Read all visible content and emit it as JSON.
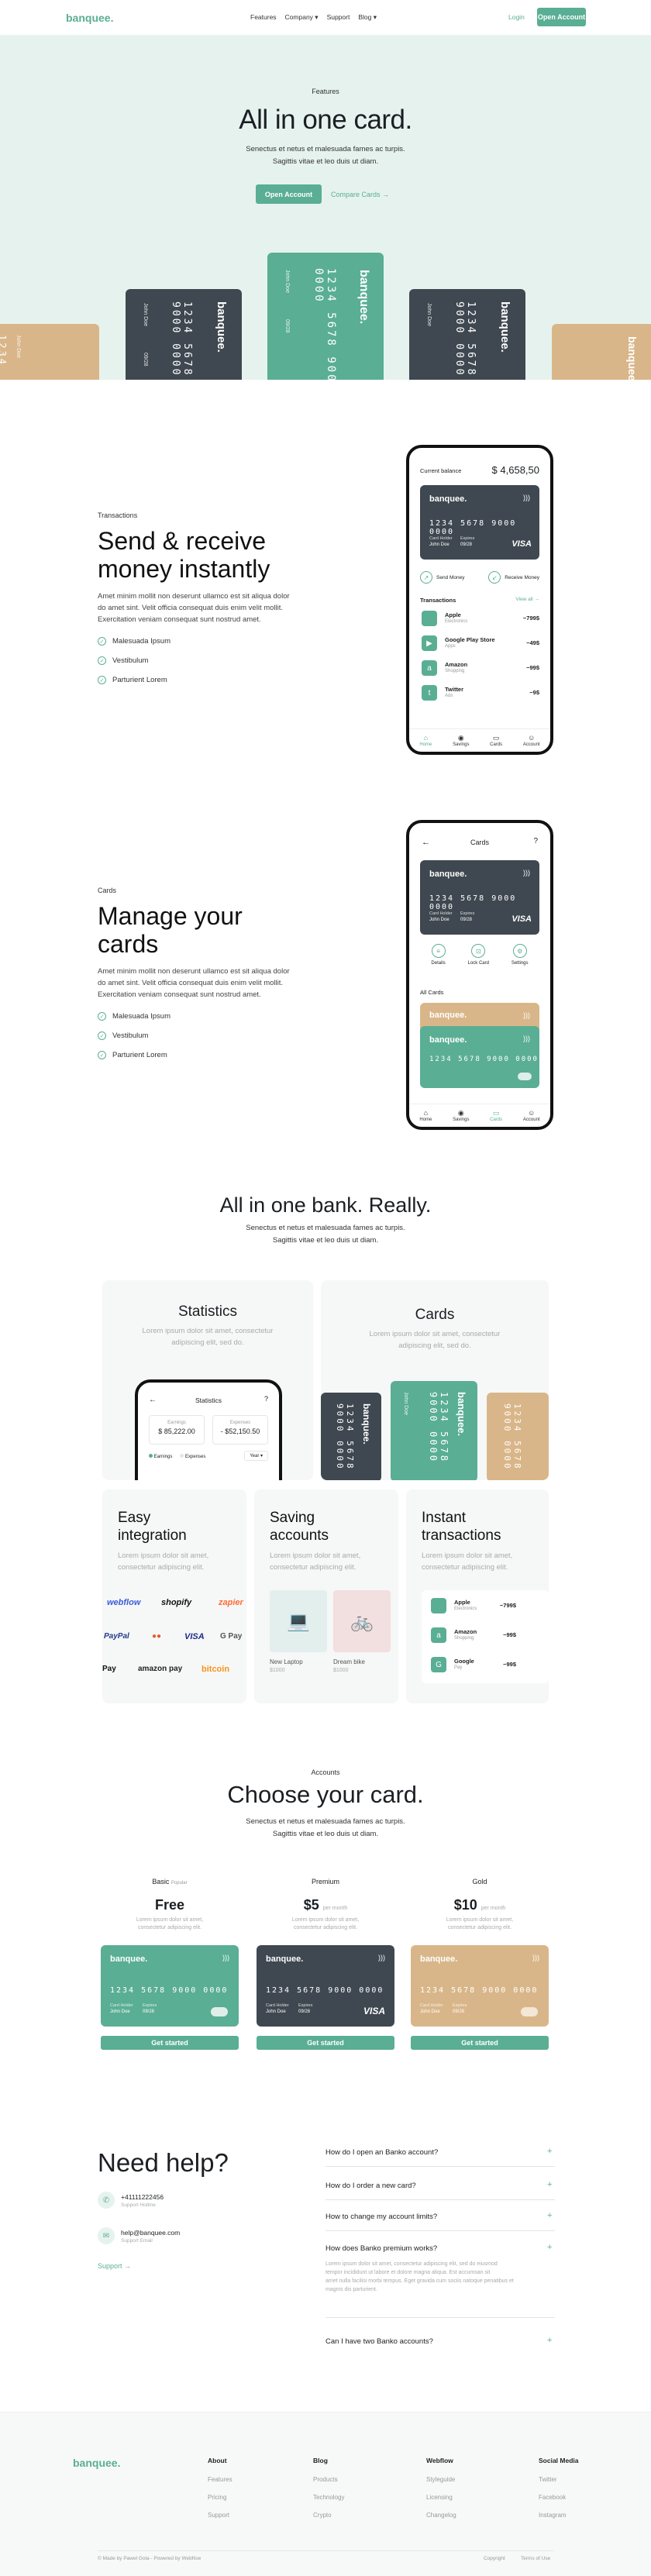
{
  "nav": {
    "logo": "banquee.",
    "links": [
      "Features",
      "Company ▾",
      "Support",
      "Blog ▾"
    ],
    "login": "Login",
    "open_account": "Open Account"
  },
  "hero": {
    "eyebrow": "Features",
    "title": "All in one card.",
    "sub1": "Senectus et netus et malesuada fames ac turpis.",
    "sub2": "Sagittis vitae et leo duis ut diam.",
    "btn_primary": "Open Account",
    "btn_secondary": "Compare Cards →"
  },
  "card": {
    "brand": "banquee.",
    "number": "1234 5678 9000 0000",
    "holder_label": "Card Holder",
    "holder": "John Doe",
    "expiry_label": "Expires",
    "expiry": "09/28",
    "network": "VISA",
    "short_num": "1234"
  },
  "transactions": {
    "eyebrow": "Transactions",
    "title1": "Send & receive",
    "title2": "money instantly",
    "para": [
      "Amet minim mollit non deserunt ullamco est sit aliqua dolor",
      "do amet sint. Velit officia consequat duis enim velit mollit.",
      "Exercitation veniam consequat sunt nostrud amet."
    ],
    "checks": [
      "Malesuada Ipsum",
      "Vestibulum",
      "Parturient Lorem"
    ],
    "phone": {
      "balance_label": "Current balance",
      "balance": "$ 4,658,50",
      "send": "Send Money",
      "receive": "Receive Money",
      "tx_title": "Transactions",
      "view_all": "View all →",
      "items": [
        {
          "name": "Apple",
          "sub": "Electronics",
          "amt": "−799$",
          "icon": "",
          "color": "#5aae93"
        },
        {
          "name": "Google Play Store",
          "sub": "Apps",
          "amt": "−49$",
          "icon": "▶",
          "color": "#5aae93"
        },
        {
          "name": "Amazon",
          "sub": "Shopping",
          "amt": "−99$",
          "icon": "a",
          "color": "#5aae93"
        },
        {
          "name": "Twitter",
          "sub": "Ads",
          "amt": "−9$",
          "icon": "t",
          "color": "#5aae93"
        }
      ],
      "tabs": [
        "Home",
        "Savings",
        "Cards",
        "Account"
      ]
    }
  },
  "cards_section": {
    "eyebrow": "Cards",
    "title1": "Manage your",
    "title2": "cards",
    "para": [
      "Amet minim mollit non deserunt ullamco est sit aliqua dolor",
      "do amet sint. Velit officia consequat duis enim velit mollit.",
      "Exercitation veniam consequat sunt nostrud amet."
    ],
    "checks": [
      "Malesuada Ipsum",
      "Vestibulum",
      "Parturient Lorem"
    ],
    "phone": {
      "title": "Cards",
      "actions": [
        "Details",
        "Lock Card",
        "Settings"
      ],
      "all_cards": "All Cards",
      "tabs": [
        "Home",
        "Savings",
        "Cards",
        "Account"
      ]
    }
  },
  "bank": {
    "title": "All in one bank. Really.",
    "sub1": "Senectus et netus et malesuada fames ac turpis.",
    "sub2": "Sagittis vitae et leo duis ut diam.",
    "stats_title": "Statistics",
    "stats_desc1": "Lorem ipsum dolor sit amet, consectetur",
    "stats_desc2": "adipiscing elit, sed do.",
    "stats_phone_title": "Statistics",
    "earnings_label": "Earnings",
    "earnings": "$ 85,222.00",
    "expenses_label": "Expenses",
    "expenses": "- $52,150.50",
    "legend_earn": "Earnings",
    "legend_exp": "Expenses",
    "period": "Year ▾",
    "cards_title": "Cards",
    "cards_desc1": "Lorem ipsum dolor sit amet, consectetur",
    "cards_desc2": "adipiscing elit, sed do.",
    "easy_title1": "Easy",
    "easy_title2": "integration",
    "easy_desc1": "Lorem ipsum dolor sit amet,",
    "easy_desc2": "consectetur adipiscing elit.",
    "logos": [
      "webflow",
      "shopify",
      "zapier",
      "PayPal",
      "●●",
      "VISA",
      "G Pay",
      " Pay",
      "amazon pay",
      "bitcoin"
    ],
    "saving_title1": "Saving",
    "saving_title2": "accounts",
    "saving_desc1": "Lorem ipsum dolor sit amet,",
    "saving_desc2": "consectetur adipiscing elit.",
    "goal1": "New Laptop",
    "goal1_amt": "$1000",
    "goal2": "Dream bike",
    "goal2_amt": "$1000",
    "instant_title1": "Instant",
    "instant_title2": "transactions",
    "instant_desc1": "Lorem ipsum dolor sit amet,",
    "instant_desc2": "consectetur adipiscing elit.",
    "tx": [
      {
        "name": "Apple",
        "sub": "Electronics",
        "amt": "−799$",
        "icon": ""
      },
      {
        "name": "Amazon",
        "sub": "Shopping",
        "amt": "−99$",
        "icon": "a"
      },
      {
        "name": "Google",
        "sub": "Pay",
        "amt": "−99$",
        "icon": "G"
      }
    ]
  },
  "plans": {
    "eyebrow": "Accounts",
    "title": "Choose your card.",
    "sub1": "Senectus et netus et malesuada fames ac turpis.",
    "sub2": "Sagittis vitae et leo duis ut diam.",
    "items": [
      {
        "name": "Basic",
        "tag": "Popular",
        "price": "Free",
        "per": "",
        "desc1": "Lorem ipsum dolor sit amet,",
        "desc2": "consectetur adipiscing elit.",
        "cta": "Get started"
      },
      {
        "name": "Premium",
        "tag": "",
        "price": "$5",
        "per": "per month",
        "desc1": "Lorem ipsum dolor sit amet,",
        "desc2": "consectetur adipiscing elit.",
        "cta": "Get started"
      },
      {
        "name": "Gold",
        "tag": "",
        "price": "$10",
        "per": "per month",
        "desc1": "Lorem ipsum dolor sit amet,",
        "desc2": "consectetur adipiscing elit.",
        "cta": "Get started"
      }
    ]
  },
  "help": {
    "title": "Need help?",
    "phone": "+41111222456",
    "phone_label": "Support Hotline",
    "email": "help@banquee.com",
    "email_label": "Support Email",
    "support": "Support →",
    "faqs": [
      "How do I open an Banko account?",
      "How do I order a new card?",
      "How to change my account limits?",
      "How does Banko premium works?",
      "Can I have two Banko accounts?"
    ],
    "answer": [
      "Lorem ipsum dolor sit amet, consectetur adipiscing elit, sed do eiusmod",
      "tempor incididunt ut labore et dolore magna aliqua. Est accumsan sit",
      "amet nulla facilisi morbi tempus. Eget gravida cum sociis natoque penatibus et",
      "magnis dis parturient."
    ]
  },
  "footer": {
    "logo": "banquee.",
    "cols": [
      {
        "head": "About",
        "items": [
          "Features",
          "Pricing",
          "Support"
        ]
      },
      {
        "head": "Blog",
        "items": [
          "Products",
          "Technology",
          "Crypto"
        ]
      },
      {
        "head": "Webflow",
        "items": [
          "Styleguide",
          "Licensing",
          "Changelog"
        ]
      },
      {
        "head": "Social Media",
        "items": [
          "Twitter",
          "Facebook",
          "Instagram"
        ]
      }
    ],
    "copyright": "© Made by Pawel Gola - Powered by Webflow",
    "links": [
      "Copyright",
      "Terms of Use"
    ]
  }
}
